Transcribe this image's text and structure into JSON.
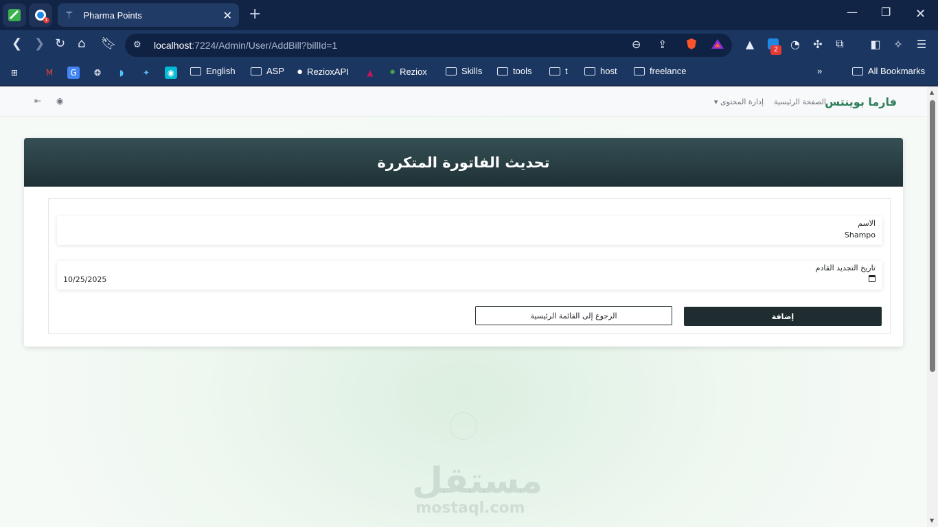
{
  "browser": {
    "tab_title": "Pharma Points",
    "pinned_badge": "1",
    "url_host": "localhost",
    "url_rest": ":7224/Admin/User/AddBill?billId=1",
    "extension_badge": "2",
    "bookmarks": [
      "English",
      "ASP",
      "RezioxAPI",
      "Reziox",
      "Skills",
      "tools",
      "t",
      "host",
      "freelance"
    ],
    "all_bookmarks": "All Bookmarks"
  },
  "navbar": {
    "brand": "فارما بوينتس",
    "home": "الصفحة الرئيسية",
    "content_management": "إدارة المحتوى"
  },
  "card": {
    "title": "تحديث الفاتورة المتكررة",
    "name_label": "الاسم",
    "name_value": "Shampo",
    "date_label": "تاريخ التجديد القادم",
    "date_value": "10/25/2025",
    "submit_label": "إضافة",
    "back_label": "الرجوع إلى القائمة الرئيسية"
  },
  "watermark": {
    "arabic": "مستقل",
    "latin": "mostaql.com"
  }
}
